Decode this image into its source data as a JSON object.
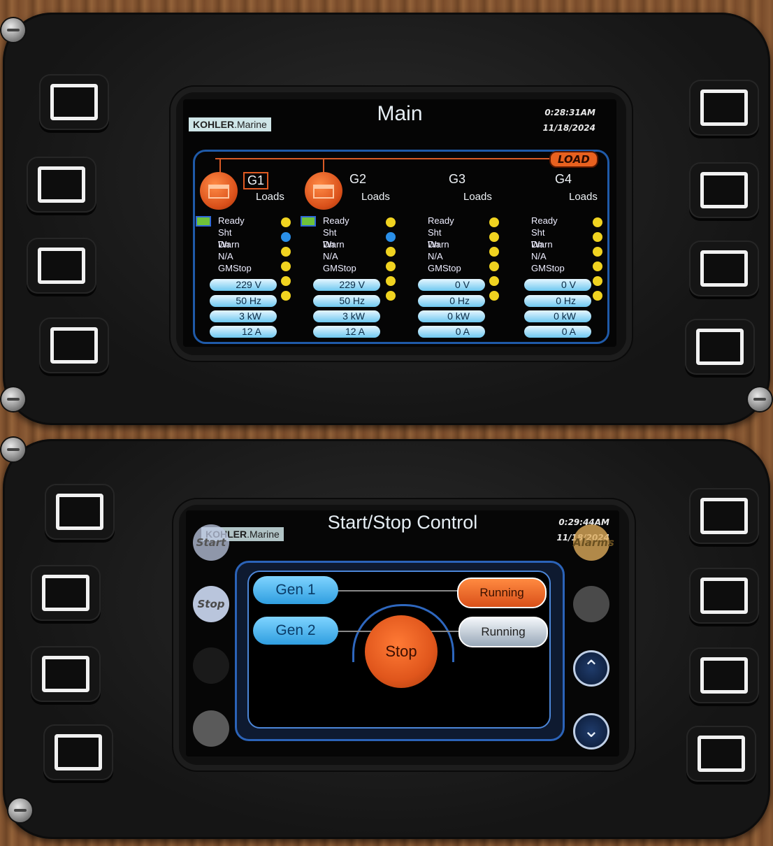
{
  "top_screen": {
    "brand": {
      "bold": "KOHLER",
      "rest": ".Marine"
    },
    "title": "Main",
    "time": "0:28:31AM",
    "date": "11/18/2024",
    "load_badge": "LOAD",
    "loads_label": "Loads",
    "status_labels": [
      "Ready",
      "Sht Dn",
      "Warn",
      "N/A",
      "GMStop"
    ],
    "generators": [
      {
        "name": "G1",
        "volts": "229 V",
        "hz": "50 Hz",
        "kw": "3 kW",
        "amps": "12 A"
      },
      {
        "name": "G2",
        "volts": "229 V",
        "hz": "50 Hz",
        "kw": "3 kW",
        "amps": "12 A"
      },
      {
        "name": "G3",
        "volts": "0 V",
        "hz": "0 Hz",
        "kw": "0 kW",
        "amps": "0 A"
      },
      {
        "name": "G4",
        "volts": "0 V",
        "hz": "0 Hz",
        "kw": "0 kW",
        "amps": "0 A"
      }
    ],
    "colors": {
      "accent_orange": "#e05a22",
      "frame_blue": "#1f5aa8",
      "indicator_yellow": "#f0d320",
      "indicator_blue": "#2a8fe8"
    }
  },
  "bottom_screen": {
    "brand": {
      "bold": "KOHLER",
      "rest": ".Marine"
    },
    "title": "Start/Stop Control",
    "time": "0:29:44AM",
    "date": "11/18/2024",
    "left_buttons": {
      "start": "Start",
      "stop": "Stop"
    },
    "right_buttons": {
      "alarms": "Alarms",
      "up_icon": "chevron-up",
      "down_icon": "chevron-down"
    },
    "gen1_label": "Gen 1",
    "gen2_label": "Gen 2",
    "gen1_status": "Running",
    "gen2_status": "Running",
    "stop_label": "Stop"
  }
}
